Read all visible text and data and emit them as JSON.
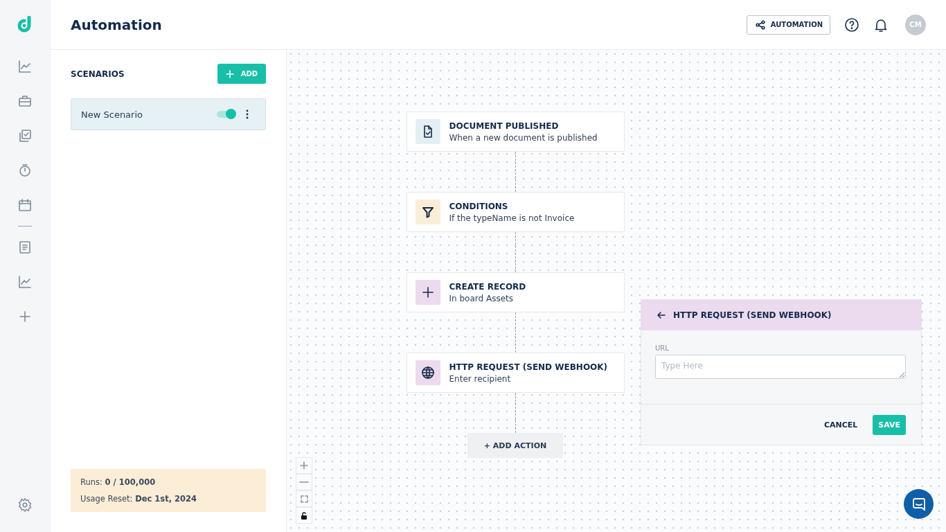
{
  "header": {
    "title": "Automation",
    "automation_button": "AUTOMATION",
    "avatar": "CM"
  },
  "scenarios": {
    "title": "SCENARIOS",
    "add_button": "ADD",
    "items": [
      {
        "name": "New Scenario",
        "selected": true,
        "on": true
      }
    ]
  },
  "usage": [
    "Runs: **0 / 100,000**",
    "Usage Reset: **Dec 1st, 2024**"
  ],
  "flow": {
    "nodes": [
      {
        "kind": "document",
        "title": "DOCUMENT PUBLISHED",
        "subtitle": "When a new document is published",
        "color": "#e4eff4"
      },
      {
        "kind": "filter",
        "title": "CONDITIONS",
        "subtitle": "If the typeName is not Invoice",
        "color": "#fbeed8"
      },
      {
        "kind": "plus",
        "title": "CREATE RECORD",
        "subtitle": "In board Assets",
        "color": "#ecdaee"
      },
      {
        "kind": "globe",
        "title": "HTTP REQUEST (SEND WEBHOOK)",
        "subtitle": "Enter recipient",
        "color": "#ecdaee"
      }
    ],
    "add_action": "+ ADD ACTION"
  },
  "panel": {
    "title": "HTTP REQUEST (SEND WEBHOOK)",
    "field_label": "URL",
    "placeholder": "Type Here",
    "cancel": "CANCEL",
    "save": "SAVE"
  }
}
